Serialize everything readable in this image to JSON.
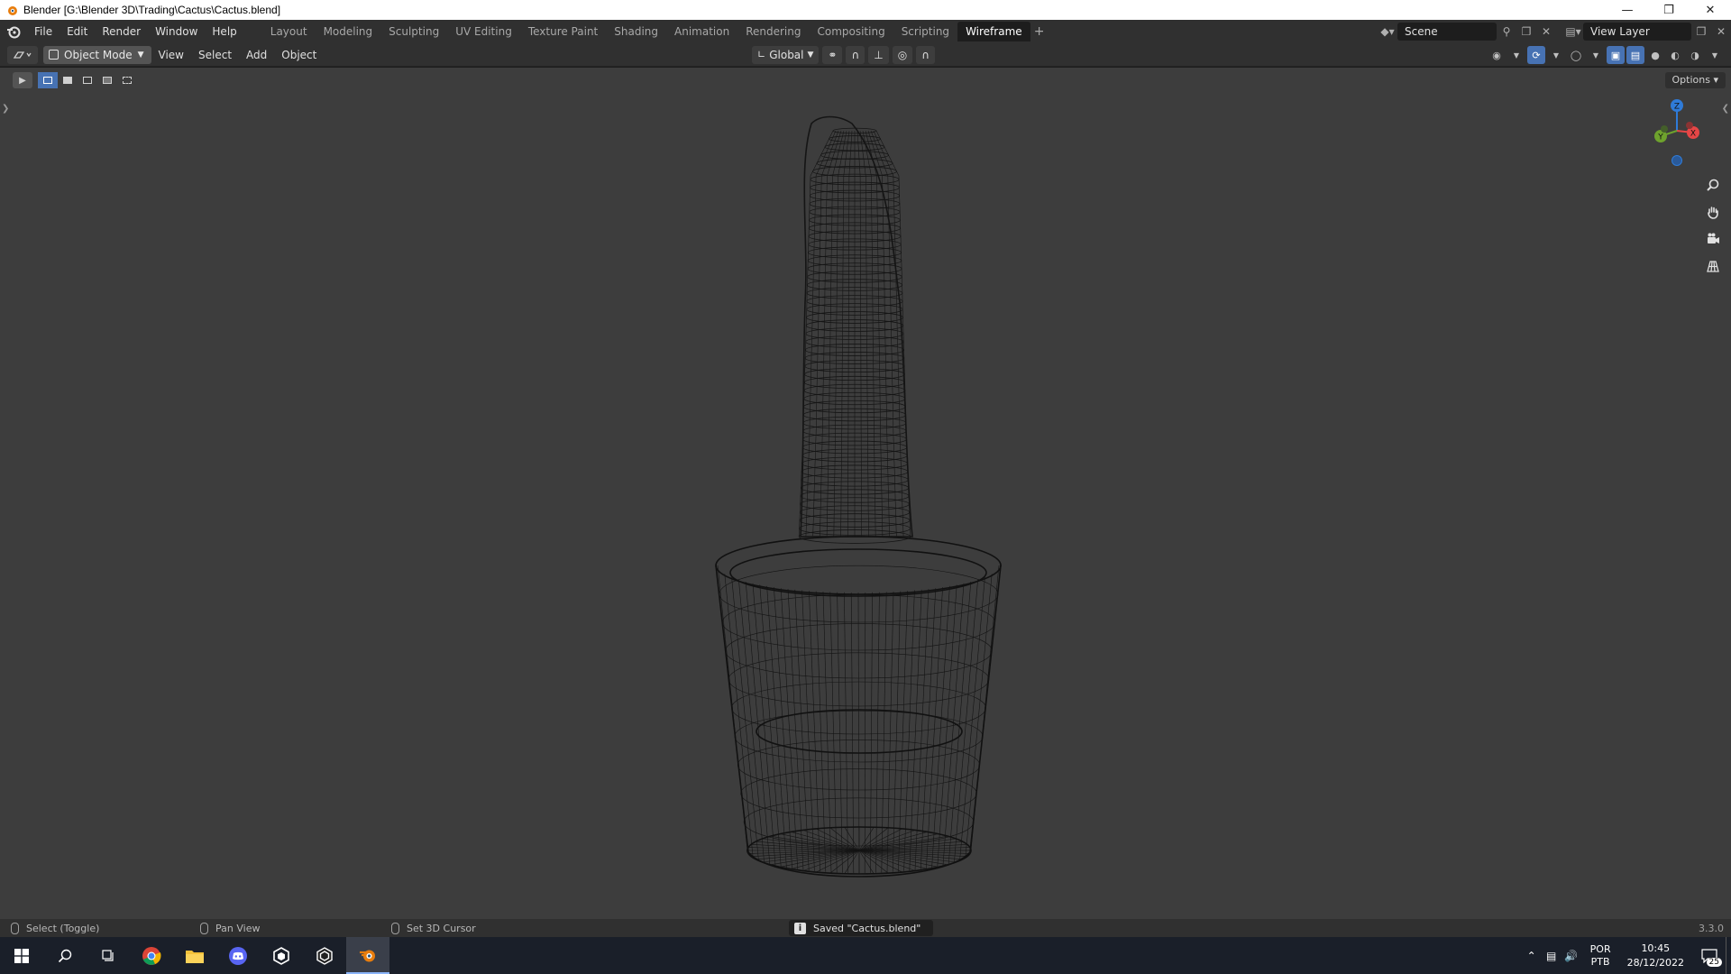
{
  "window": {
    "title": "Blender [G:\\Blender 3D\\Trading\\Cactus\\Cactus.blend]",
    "controls": [
      "minimize",
      "restore",
      "close"
    ]
  },
  "topbar": {
    "menus": [
      "File",
      "Edit",
      "Render",
      "Window",
      "Help"
    ],
    "workspaces": [
      "Layout",
      "Modeling",
      "Sculpting",
      "UV Editing",
      "Texture Paint",
      "Shading",
      "Animation",
      "Rendering",
      "Compositing",
      "Scripting",
      "Wireframe"
    ],
    "active_workspace": "Wireframe",
    "add_symbol": "+",
    "scene": "Scene",
    "view_layer": "View Layer"
  },
  "viewport_header": {
    "mode": "Object Mode",
    "menus": [
      "View",
      "Select",
      "Add",
      "Object"
    ],
    "transform_orientation": "Global"
  },
  "viewport": {
    "options_label": "Options",
    "shading_mode": "wireframe",
    "gizmo_axes": [
      "Z",
      "Y",
      "X"
    ],
    "gizmo_colors": {
      "x": "#e64646",
      "y": "#6ea22d",
      "z": "#2f7bd8"
    },
    "nav_icons": [
      "zoom-icon",
      "pan-hand-icon",
      "camera-icon",
      "ortho-grid-icon"
    ]
  },
  "statusbar": {
    "hint_select": "Select (Toggle)",
    "hint_pan": "Pan View",
    "hint_cursor": "Set 3D Cursor",
    "message": "Saved \"Cactus.blend\"",
    "version": "3.3.0"
  },
  "taskbar": {
    "apps": [
      "windows-start-icon",
      "search-icon",
      "task-view-icon",
      "chrome-icon",
      "file-explorer-icon",
      "discord-icon",
      "unity-hub-icon",
      "unity-icon",
      "blender-icon"
    ],
    "lang_top": "POR",
    "lang_bottom": "PTB",
    "time": "10:45",
    "date": "28/12/2022",
    "notifications": "25"
  }
}
